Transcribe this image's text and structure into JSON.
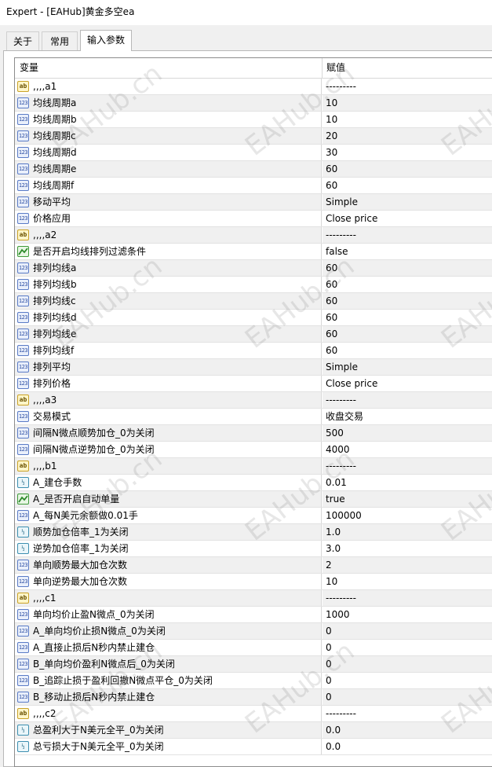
{
  "window": {
    "title": "Expert - [EAHub]黄金多空ea"
  },
  "tabs": [
    {
      "label": "关于",
      "active": false
    },
    {
      "label": "常用",
      "active": false
    },
    {
      "label": "输入参数",
      "active": true
    }
  ],
  "grid": {
    "col_variable": "变量",
    "col_value": "赋值",
    "rows": [
      {
        "icon": "string-icon",
        "name": ",,,,a1",
        "value": "---------"
      },
      {
        "icon": "integer-icon",
        "name": "均线周期a",
        "value": "10"
      },
      {
        "icon": "integer-icon",
        "name": "均线周期b",
        "value": "10"
      },
      {
        "icon": "integer-icon",
        "name": "均线周期c",
        "value": "20"
      },
      {
        "icon": "integer-icon",
        "name": "均线周期d",
        "value": "30"
      },
      {
        "icon": "integer-icon",
        "name": "均线周期e",
        "value": "60"
      },
      {
        "icon": "integer-icon",
        "name": "均线周期f",
        "value": "60"
      },
      {
        "icon": "integer-icon",
        "name": "移动平均",
        "value": "Simple"
      },
      {
        "icon": "integer-icon",
        "name": "价格应用",
        "value": "Close price"
      },
      {
        "icon": "string-icon",
        "name": ",,,,a2",
        "value": "---------"
      },
      {
        "icon": "boolean-icon",
        "name": "是否开启均线排列过滤条件",
        "value": "false"
      },
      {
        "icon": "integer-icon",
        "name": "排列均线a",
        "value": "60"
      },
      {
        "icon": "integer-icon",
        "name": "排列均线b",
        "value": "60"
      },
      {
        "icon": "integer-icon",
        "name": "排列均线c",
        "value": "60"
      },
      {
        "icon": "integer-icon",
        "name": "排列均线d",
        "value": "60"
      },
      {
        "icon": "integer-icon",
        "name": "排列均线e",
        "value": "60"
      },
      {
        "icon": "integer-icon",
        "name": "排列均线f",
        "value": "60"
      },
      {
        "icon": "integer-icon",
        "name": "排列平均",
        "value": "Simple"
      },
      {
        "icon": "integer-icon",
        "name": "排列价格",
        "value": "Close price"
      },
      {
        "icon": "string-icon",
        "name": ",,,,a3",
        "value": "---------"
      },
      {
        "icon": "integer-icon",
        "name": "交易模式",
        "value": "收盘交易"
      },
      {
        "icon": "integer-icon",
        "name": "间隔N微点顺势加仓_0为关闭",
        "value": "500"
      },
      {
        "icon": "integer-icon",
        "name": "间隔N微点逆势加仓_0为关闭",
        "value": "4000"
      },
      {
        "icon": "string-icon",
        "name": ",,,,b1",
        "value": "---------"
      },
      {
        "icon": "double-icon",
        "name": "A_建仓手数",
        "value": "0.01"
      },
      {
        "icon": "boolean-icon",
        "name": "A_是否开启自动单量",
        "value": "true"
      },
      {
        "icon": "integer-icon",
        "name": "A_每N美元余额做0.01手",
        "value": "100000"
      },
      {
        "icon": "double-icon",
        "name": "顺势加仓倍率_1为关闭",
        "value": "1.0"
      },
      {
        "icon": "double-icon",
        "name": "逆势加仓倍率_1为关闭",
        "value": "3.0"
      },
      {
        "icon": "integer-icon",
        "name": "单向顺势最大加仓次数",
        "value": "2"
      },
      {
        "icon": "integer-icon",
        "name": "单向逆势最大加仓次数",
        "value": "10"
      },
      {
        "icon": "string-icon",
        "name": ",,,,c1",
        "value": "---------"
      },
      {
        "icon": "integer-icon",
        "name": "单向均价止盈N微点_0为关闭",
        "value": "1000"
      },
      {
        "icon": "integer-icon",
        "name": "A_单向均价止损N微点_0为关闭",
        "value": "0"
      },
      {
        "icon": "integer-icon",
        "name": "A_直接止损后N秒内禁止建仓",
        "value": "0"
      },
      {
        "icon": "integer-icon",
        "name": "B_单向均价盈利N微点后_0为关闭",
        "value": "0"
      },
      {
        "icon": "integer-icon",
        "name": "B_追踪止损于盈利回撤N微点平仓_0为关闭",
        "value": "0"
      },
      {
        "icon": "integer-icon",
        "name": "B_移动止损后N秒内禁止建仓",
        "value": "0"
      },
      {
        "icon": "string-icon",
        "name": ",,,,c2",
        "value": "---------"
      },
      {
        "icon": "double-icon",
        "name": "总盈利大于N美元全平_0为关闭",
        "value": "0.0"
      },
      {
        "icon": "double-icon",
        "name": "总亏损大于N美元全平_0为关闭",
        "value": "0.0"
      }
    ]
  },
  "watermark": {
    "text": "EAHub.cn"
  }
}
